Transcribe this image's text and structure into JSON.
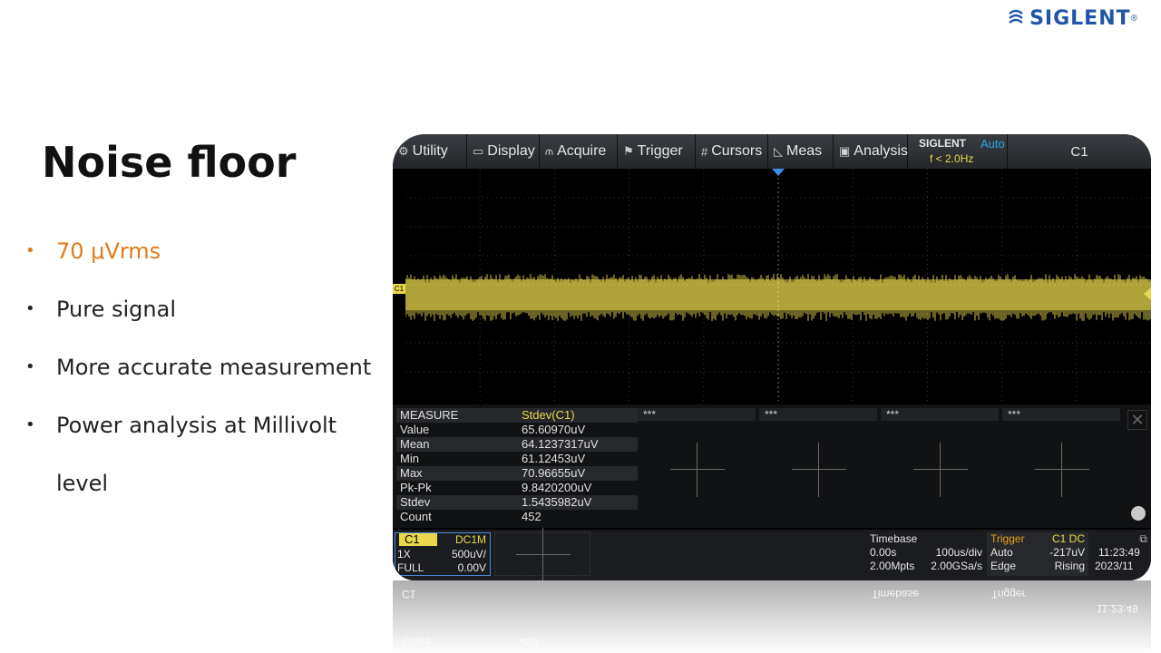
{
  "brand": {
    "name": "SIGLENT",
    "reg": "®",
    "color": "#1f55a8"
  },
  "slide": {
    "title": "Noise floor",
    "bullets": [
      {
        "text": "70 μVrms",
        "highlight": true
      },
      {
        "text": "Pure signal",
        "highlight": false
      },
      {
        "text": "More accurate measurement",
        "highlight": false
      },
      {
        "text": "Power analysis at Millivolt",
        "highlight": false
      },
      {
        "text": "level",
        "highlight": false,
        "continuation": true
      }
    ],
    "bullet_glyph": "•",
    "highlight_color": "#e07b1a"
  },
  "scope": {
    "menu": [
      {
        "label": "Utility",
        "icon": "gear-icon",
        "glyph": "⚙"
      },
      {
        "label": "Display",
        "icon": "monitor-icon",
        "glyph": "▭"
      },
      {
        "label": "Acquire",
        "icon": "acquire-icon",
        "glyph": "⫙"
      },
      {
        "label": "Trigger",
        "icon": "flag-icon",
        "glyph": "⚑"
      },
      {
        "label": "Cursors",
        "icon": "cursors-icon",
        "glyph": "#"
      },
      {
        "label": "Meas",
        "icon": "meas-icon",
        "glyph": "◺"
      },
      {
        "label": "Analysis",
        "icon": "analysis-icon",
        "glyph": "▣"
      }
    ],
    "logo_text": "SIGLENT",
    "trigger_mode": "Auto",
    "frequency": "f < 2.0Hz",
    "active_channel": "C1",
    "channel_marker": "C1",
    "trace_color": "#e8d84a",
    "measure": {
      "header_key": "MEASURE",
      "header_value": "Stdev(C1)",
      "rows": [
        {
          "k": "Value",
          "v": "65.60970uV"
        },
        {
          "k": "Mean",
          "v": "64.1237317uV"
        },
        {
          "k": "Min",
          "v": "61.12453uV"
        },
        {
          "k": "Max",
          "v": "70.96655uV"
        },
        {
          "k": "Pk-Pk",
          "v": "9.8420200uV"
        },
        {
          "k": "Stdev",
          "v": "1.5435982uV"
        },
        {
          "k": "Count",
          "v": "452"
        }
      ],
      "slots": [
        "***",
        "***",
        "***",
        "***"
      ]
    },
    "channel_box": {
      "name": "C1",
      "coupling": "DC1M",
      "probe": "1X",
      "scale": "500uV/",
      "bw": "FULL",
      "offset": "0.00V"
    },
    "timebase": {
      "label": "Timebase",
      "delay": "0.00s",
      "scale": "100us/div",
      "memory": "2.00Mpts",
      "rate": "2.00GSa/s"
    },
    "trigger": {
      "label": "Trigger",
      "source": "C1 DC",
      "mode": "Auto",
      "level": "-217uV",
      "type": "Edge",
      "slope": "Rising"
    },
    "clock": {
      "time": "11:23:49",
      "date": "2023/11"
    }
  }
}
